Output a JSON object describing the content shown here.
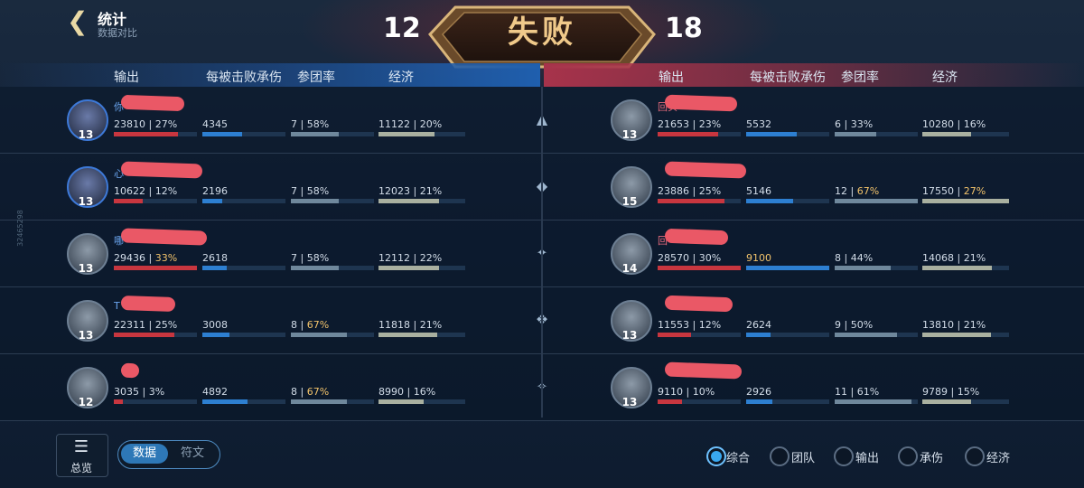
{
  "header": {
    "back_icon": "chevron-left-icon",
    "title": "统计",
    "subtitle": "数据对比",
    "score_left": "12",
    "score_right": "18",
    "result": "失败"
  },
  "columns": {
    "left": [
      "输出",
      "每被击败承伤",
      "参团率",
      "经济"
    ],
    "right": [
      "输出",
      "每被击败承伤",
      "参团率",
      "经济"
    ]
  },
  "colors": {
    "accent_blue": "#2d7fd1",
    "accent_red": "#c8363f",
    "highlight": "#f2c36b"
  },
  "left_team": [
    {
      "name": "你",
      "level": "13",
      "damage": "23810",
      "damage_pct": "27%",
      "damage_fill": 0.77,
      "tank": "4345",
      "tank_fill": 0.48,
      "kp": "7",
      "kp_pct": "58%",
      "kp_fill": 0.58,
      "gold": "11122",
      "gold_pct": "20%",
      "gold_fill": 0.65
    },
    {
      "name": "心",
      "level": "13",
      "damage": "10622",
      "damage_pct": "12%",
      "damage_fill": 0.35,
      "tank": "2196",
      "tank_fill": 0.24,
      "kp": "7",
      "kp_pct": "58%",
      "kp_fill": 0.58,
      "gold": "12023",
      "gold_pct": "21%",
      "gold_fill": 0.7
    },
    {
      "name": "哪",
      "level": "13",
      "damage": "29436",
      "damage_pct": "33%",
      "damage_fill": 1.0,
      "tank": "2618",
      "tank_fill": 0.29,
      "kp": "7",
      "kp_pct": "58%",
      "kp_fill": 0.58,
      "gold": "12112",
      "gold_pct": "22%",
      "gold_fill": 0.7
    },
    {
      "name": "T",
      "level": "13",
      "damage": "22311",
      "damage_pct": "25%",
      "damage_fill": 0.73,
      "tank": "3008",
      "tank_fill": 0.33,
      "kp": "8",
      "kp_pct": "67%",
      "kp_fill": 0.67,
      "gold": "11818",
      "gold_pct": "21%",
      "gold_fill": 0.68
    },
    {
      "name": "",
      "level": "12",
      "damage": "3035",
      "damage_pct": "3%",
      "damage_fill": 0.11,
      "tank": "4892",
      "tank_fill": 0.54,
      "kp": "8",
      "kp_pct": "67%",
      "kp_fill": 0.67,
      "gold": "8990",
      "gold_pct": "16%",
      "gold_fill": 0.52
    }
  ],
  "right_team": [
    {
      "name": "回头",
      "level": "13",
      "damage": "21653",
      "damage_pct": "23%",
      "damage_fill": 0.73,
      "tank": "5532",
      "tank_fill": 0.61,
      "kp": "6",
      "kp_pct": "33%",
      "kp_fill": 0.5,
      "gold": "10280",
      "gold_pct": "16%",
      "gold_fill": 0.56
    },
    {
      "name": "",
      "level": "15",
      "damage": "23886",
      "damage_pct": "25%",
      "damage_fill": 0.8,
      "tank": "5146",
      "tank_fill": 0.56,
      "kp": "12",
      "kp_pct": "67%",
      "kp_fill": 1.0,
      "gold": "17550",
      "gold_pct": "27%",
      "gold_fill": 1.0
    },
    {
      "name": "回",
      "level": "14",
      "damage": "28570",
      "damage_pct": "30%",
      "damage_fill": 1.0,
      "tank": "9100",
      "tank_fill": 1.0,
      "kp": "8",
      "kp_pct": "44%",
      "kp_fill": 0.67,
      "gold": "14068",
      "gold_pct": "21%",
      "gold_fill": 0.8
    },
    {
      "name": "",
      "level": "13",
      "damage": "11553",
      "damage_pct": "12%",
      "damage_fill": 0.4,
      "tank": "2624",
      "tank_fill": 0.29,
      "kp": "9",
      "kp_pct": "50%",
      "kp_fill": 0.75,
      "gold": "13810",
      "gold_pct": "21%",
      "gold_fill": 0.79
    },
    {
      "name": "",
      "level": "13",
      "damage": "9110",
      "damage_pct": "10%",
      "damage_fill": 0.29,
      "tank": "2926",
      "tank_fill": 0.32,
      "kp": "11",
      "kp_pct": "61%",
      "kp_fill": 0.92,
      "gold": "9789",
      "gold_pct": "15%",
      "gold_fill": 0.56
    }
  ],
  "highlights": {
    "left": [
      [],
      [],
      [
        "damage_pct"
      ],
      [
        "kp_pct"
      ],
      [
        "kp_pct"
      ]
    ],
    "right": [
      [],
      [
        "kp_pct",
        "gold_pct"
      ],
      [
        "tank"
      ],
      [],
      []
    ]
  },
  "footer": {
    "overview_icon": "list-icon",
    "overview_label": "总览",
    "tab_data": "数据",
    "tab_rune": "符文",
    "filters": [
      "综合",
      "团队",
      "输出",
      "承伤",
      "经济"
    ],
    "selected_filter": "综合"
  },
  "side_code": "32465298"
}
